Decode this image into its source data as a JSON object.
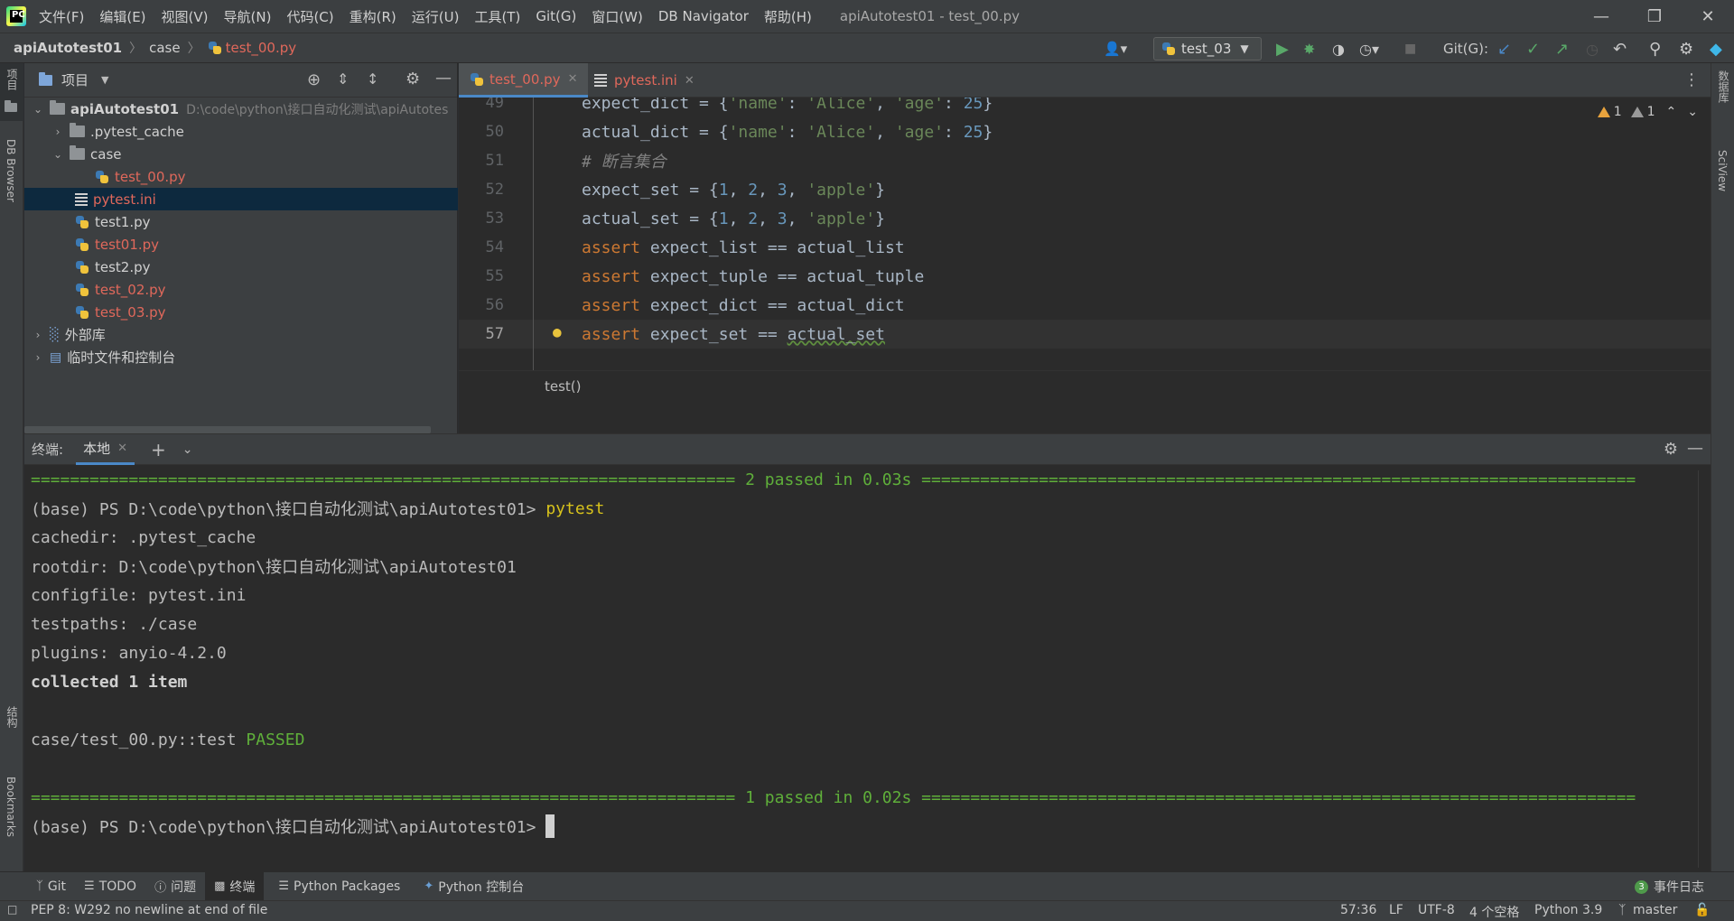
{
  "menubar": {
    "items": [
      "文件(F)",
      "编辑(E)",
      "视图(V)",
      "导航(N)",
      "代码(C)",
      "重构(R)",
      "运行(U)",
      "工具(T)",
      "Git(G)",
      "窗口(W)",
      "DB Navigator",
      "帮助(H)"
    ],
    "window_title": "apiAutotest01 - test_00.py"
  },
  "navbar": {
    "crumbs": [
      "apiAutotest01",
      "case",
      "test_00.py"
    ],
    "run_config": "test_03",
    "git_label": "Git(G):"
  },
  "left_strip": {
    "project": "项目",
    "db_browser": "DB Browser",
    "structure": "结构",
    "bookmarks": "Bookmarks"
  },
  "right_strip": {
    "database": "数据库",
    "sciview": "SciView"
  },
  "project_panel": {
    "title": "项目",
    "tree": [
      {
        "label": "apiAutotest01",
        "path": "D:\\code\\python\\接口自动化测试\\apiAutotes"
      },
      {
        "label": ".pytest_cache"
      },
      {
        "label": "case"
      },
      {
        "label": "test_00.py"
      },
      {
        "label": "pytest.ini"
      },
      {
        "label": "test1.py"
      },
      {
        "label": "test01.py"
      },
      {
        "label": "test2.py"
      },
      {
        "label": "test_02.py"
      },
      {
        "label": "test_03.py"
      },
      {
        "label": "外部库"
      },
      {
        "label": "临时文件和控制台"
      }
    ]
  },
  "editor": {
    "tabs": [
      "test_00.py",
      "pytest.ini"
    ],
    "inspection": {
      "warnings": "1",
      "weak_warnings": "1"
    },
    "lines": [
      {
        "n": "49",
        "html": "expect_dict = {<span class=\"str\">'name'</span>: <span class=\"str\">'Alice'</span>, <span class=\"str\">'age'</span>: <span class=\"num\">25</span>}"
      },
      {
        "n": "50",
        "html": "actual_dict = {<span class=\"str\">'name'</span>: <span class=\"str\">'Alice'</span>, <span class=\"str\">'age'</span>: <span class=\"num\">25</span>}"
      },
      {
        "n": "51",
        "html": "<span class=\"cmt\"># 断言集合</span>"
      },
      {
        "n": "52",
        "html": "expect_set = {<span class=\"num\">1</span>, <span class=\"num\">2</span>, <span class=\"num\">3</span>, <span class=\"str\">'apple'</span>}"
      },
      {
        "n": "53",
        "html": "actual_set = {<span class=\"num\">1</span>, <span class=\"num\">2</span>, <span class=\"num\">3</span>, <span class=\"str\">'apple'</span>}"
      },
      {
        "n": "54",
        "html": "<span class=\"kw\">assert</span> expect_list == actual_list"
      },
      {
        "n": "55",
        "html": "<span class=\"kw\">assert</span> expect_tuple == actual_tuple"
      },
      {
        "n": "56",
        "html": "<span class=\"kw\">assert</span> expect_dict == actual_dict"
      },
      {
        "n": "57",
        "html": "<span class=\"kw\">assert</span> expect_set == <span style=\"text-decoration: underline wavy #5f8f3f;\">actual_set</span>"
      }
    ],
    "breadcrumb": "test()"
  },
  "terminal": {
    "title": "终端:",
    "tab": "本地",
    "sep_line_1": "======================================================================== 2 passed in 0.03s =========================================================================",
    "prompt": "(base) PS D:\\code\\python\\接口自动化测试\\apiAutotest01> ",
    "command": "pytest",
    "cachedir": "cachedir: .pytest_cache",
    "rootdir": "rootdir: D:\\code\\python\\接口自动化测试\\apiAutotest01",
    "configfile": "configfile: pytest.ini",
    "testpaths": "testpaths: ./case",
    "plugins": "plugins: anyio-4.2.0",
    "collected": "collected 1 item",
    "test_result_name": "case/test_00.py::test ",
    "test_result_status": "PASSED",
    "sep_line_2": "======================================================================== 1 passed in 0.02s ========================================================================="
  },
  "bottom_tools": [
    "Git",
    "TODO",
    "问题",
    "终端",
    "Python Packages",
    "Python 控制台"
  ],
  "event_log": {
    "badge": "3",
    "label": "事件日志"
  },
  "statusbar": {
    "message": "PEP 8: W292 no newline at end of file",
    "position": "57:36",
    "line_sep": "LF",
    "encoding": "UTF-8",
    "indent": "4 个空格",
    "interpreter": "Python 3.9",
    "branch": "master"
  },
  "colors": {
    "accent": "#4a88c7",
    "modified_file": "#e0685b",
    "passed": "#5faf3a",
    "keyword": "#cc7832",
    "string": "#6a8759",
    "number": "#6897bb"
  }
}
